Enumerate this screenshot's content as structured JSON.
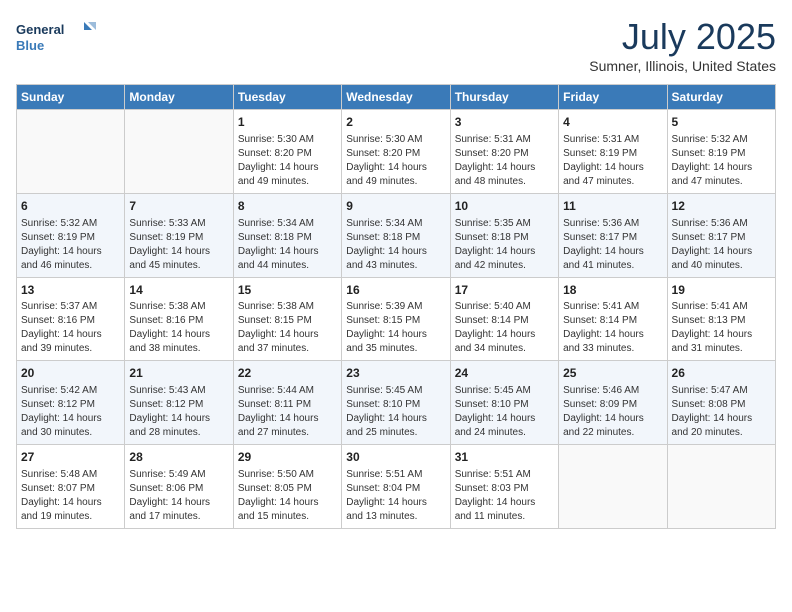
{
  "header": {
    "logo_line1": "General",
    "logo_line2": "Blue",
    "month": "July 2025",
    "location": "Sumner, Illinois, United States"
  },
  "days_of_week": [
    "Sunday",
    "Monday",
    "Tuesday",
    "Wednesday",
    "Thursday",
    "Friday",
    "Saturday"
  ],
  "weeks": [
    [
      {
        "day": "",
        "info": ""
      },
      {
        "day": "",
        "info": ""
      },
      {
        "day": "1",
        "info": "Sunrise: 5:30 AM\nSunset: 8:20 PM\nDaylight: 14 hours\nand 49 minutes."
      },
      {
        "day": "2",
        "info": "Sunrise: 5:30 AM\nSunset: 8:20 PM\nDaylight: 14 hours\nand 49 minutes."
      },
      {
        "day": "3",
        "info": "Sunrise: 5:31 AM\nSunset: 8:20 PM\nDaylight: 14 hours\nand 48 minutes."
      },
      {
        "day": "4",
        "info": "Sunrise: 5:31 AM\nSunset: 8:19 PM\nDaylight: 14 hours\nand 47 minutes."
      },
      {
        "day": "5",
        "info": "Sunrise: 5:32 AM\nSunset: 8:19 PM\nDaylight: 14 hours\nand 47 minutes."
      }
    ],
    [
      {
        "day": "6",
        "info": "Sunrise: 5:32 AM\nSunset: 8:19 PM\nDaylight: 14 hours\nand 46 minutes."
      },
      {
        "day": "7",
        "info": "Sunrise: 5:33 AM\nSunset: 8:19 PM\nDaylight: 14 hours\nand 45 minutes."
      },
      {
        "day": "8",
        "info": "Sunrise: 5:34 AM\nSunset: 8:18 PM\nDaylight: 14 hours\nand 44 minutes."
      },
      {
        "day": "9",
        "info": "Sunrise: 5:34 AM\nSunset: 8:18 PM\nDaylight: 14 hours\nand 43 minutes."
      },
      {
        "day": "10",
        "info": "Sunrise: 5:35 AM\nSunset: 8:18 PM\nDaylight: 14 hours\nand 42 minutes."
      },
      {
        "day": "11",
        "info": "Sunrise: 5:36 AM\nSunset: 8:17 PM\nDaylight: 14 hours\nand 41 minutes."
      },
      {
        "day": "12",
        "info": "Sunrise: 5:36 AM\nSunset: 8:17 PM\nDaylight: 14 hours\nand 40 minutes."
      }
    ],
    [
      {
        "day": "13",
        "info": "Sunrise: 5:37 AM\nSunset: 8:16 PM\nDaylight: 14 hours\nand 39 minutes."
      },
      {
        "day": "14",
        "info": "Sunrise: 5:38 AM\nSunset: 8:16 PM\nDaylight: 14 hours\nand 38 minutes."
      },
      {
        "day": "15",
        "info": "Sunrise: 5:38 AM\nSunset: 8:15 PM\nDaylight: 14 hours\nand 37 minutes."
      },
      {
        "day": "16",
        "info": "Sunrise: 5:39 AM\nSunset: 8:15 PM\nDaylight: 14 hours\nand 35 minutes."
      },
      {
        "day": "17",
        "info": "Sunrise: 5:40 AM\nSunset: 8:14 PM\nDaylight: 14 hours\nand 34 minutes."
      },
      {
        "day": "18",
        "info": "Sunrise: 5:41 AM\nSunset: 8:14 PM\nDaylight: 14 hours\nand 33 minutes."
      },
      {
        "day": "19",
        "info": "Sunrise: 5:41 AM\nSunset: 8:13 PM\nDaylight: 14 hours\nand 31 minutes."
      }
    ],
    [
      {
        "day": "20",
        "info": "Sunrise: 5:42 AM\nSunset: 8:12 PM\nDaylight: 14 hours\nand 30 minutes."
      },
      {
        "day": "21",
        "info": "Sunrise: 5:43 AM\nSunset: 8:12 PM\nDaylight: 14 hours\nand 28 minutes."
      },
      {
        "day": "22",
        "info": "Sunrise: 5:44 AM\nSunset: 8:11 PM\nDaylight: 14 hours\nand 27 minutes."
      },
      {
        "day": "23",
        "info": "Sunrise: 5:45 AM\nSunset: 8:10 PM\nDaylight: 14 hours\nand 25 minutes."
      },
      {
        "day": "24",
        "info": "Sunrise: 5:45 AM\nSunset: 8:10 PM\nDaylight: 14 hours\nand 24 minutes."
      },
      {
        "day": "25",
        "info": "Sunrise: 5:46 AM\nSunset: 8:09 PM\nDaylight: 14 hours\nand 22 minutes."
      },
      {
        "day": "26",
        "info": "Sunrise: 5:47 AM\nSunset: 8:08 PM\nDaylight: 14 hours\nand 20 minutes."
      }
    ],
    [
      {
        "day": "27",
        "info": "Sunrise: 5:48 AM\nSunset: 8:07 PM\nDaylight: 14 hours\nand 19 minutes."
      },
      {
        "day": "28",
        "info": "Sunrise: 5:49 AM\nSunset: 8:06 PM\nDaylight: 14 hours\nand 17 minutes."
      },
      {
        "day": "29",
        "info": "Sunrise: 5:50 AM\nSunset: 8:05 PM\nDaylight: 14 hours\nand 15 minutes."
      },
      {
        "day": "30",
        "info": "Sunrise: 5:51 AM\nSunset: 8:04 PM\nDaylight: 14 hours\nand 13 minutes."
      },
      {
        "day": "31",
        "info": "Sunrise: 5:51 AM\nSunset: 8:03 PM\nDaylight: 14 hours\nand 11 minutes."
      },
      {
        "day": "",
        "info": ""
      },
      {
        "day": "",
        "info": ""
      }
    ]
  ]
}
